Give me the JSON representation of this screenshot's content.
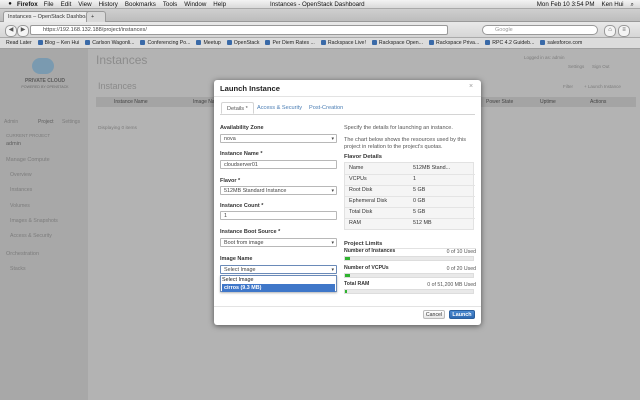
{
  "menubar": {
    "app": "Firefox",
    "items": [
      "File",
      "Edit",
      "View",
      "History",
      "Bookmarks",
      "Tools",
      "Window",
      "Help"
    ],
    "window_title": "Instances - OpenStack Dashboard",
    "user": "Ken Hui",
    "clock": "Mon Feb 10  3:54 PM"
  },
  "browser": {
    "tab_title": "Instances – OpenStack Dashboa...",
    "new_tab": "+",
    "url": "https://192.168.132.188/project/instances/",
    "search_placeholder": "Google",
    "bookmarks": [
      "Read Later",
      "Blog – Ken Hui",
      "Carlson Wagonli...",
      "Conferencing Po...",
      "Meetup",
      "OpenStack",
      "Per Diem Rates ...",
      "Rackspace Live!",
      "Rackspace Open...",
      "Rackspace Priva...",
      "RPC 4.2 Guideb...",
      "salesforce.com"
    ]
  },
  "dashboard": {
    "logo_line1": "PRIVATE CLOUD",
    "logo_line2": "POWERED BY OPENSTACK",
    "page_title": "Instances",
    "subtitle": "Instances",
    "sidebar_tabs": [
      "Admin",
      "Project",
      "Settings"
    ],
    "project_label": "CURRENT PROJECT",
    "project_name": "admin",
    "manage_compute": "Manage Compute",
    "nav": [
      "Overview",
      "Instances",
      "Volumes",
      "Images & Snapshots",
      "Access & Security"
    ],
    "orchestration": "Orchestration",
    "stacks": "Stacks",
    "logged_in": "Logged in as: admin",
    "settings_link": "Settings",
    "signout": "Sign Out",
    "filter_btn": "Filter",
    "launch_btn": "+ Launch Instance",
    "columns": [
      "Instance Name",
      "Image Name",
      "Power State",
      "Uptime",
      "Actions"
    ],
    "displaying": "Displaying 0 items"
  },
  "modal": {
    "title": "Launch Instance",
    "close": "×",
    "tabs": [
      "Details *",
      "Access & Security",
      "Post-Creation"
    ],
    "availability_zone_label": "Availability Zone",
    "availability_zone_value": "nova",
    "instance_name_label": "Instance Name *",
    "instance_name_value": "cloudserver01",
    "flavor_label": "Flavor *",
    "flavor_value": "512MB Standard Instance",
    "instance_count_label": "Instance Count *",
    "instance_count_value": "1",
    "boot_source_label": "Instance Boot Source *",
    "boot_source_value": "Boot from image",
    "image_name_label": "Image Name",
    "image_name_value": "Select Image",
    "image_options": [
      "Select Image",
      "cirros (9.3 MB)"
    ],
    "help_line1": "Specify the details for launching an instance.",
    "help_line2": "The chart below shows the resources used by this project in relation to the project's quotas.",
    "flavor_details_title": "Flavor Details",
    "flavor_details": [
      {
        "k": "Name",
        "v": "512MB Stand..."
      },
      {
        "k": "VCPUs",
        "v": "1"
      },
      {
        "k": "Root Disk",
        "v": "5 GB"
      },
      {
        "k": "Ephemeral Disk",
        "v": "0 GB"
      },
      {
        "k": "Total Disk",
        "v": "5 GB"
      },
      {
        "k": "RAM",
        "v": "512 MB"
      }
    ],
    "limits_title": "Project Limits",
    "limits": [
      {
        "label": "Number of Instances",
        "usage": "0 of 10 Used",
        "fill": 0.04
      },
      {
        "label": "Number of VCPUs",
        "usage": "0 of 20 Used",
        "fill": 0.04
      },
      {
        "label": "Total RAM",
        "usage": "0 of 51,200 MB Used",
        "fill": 0.01
      }
    ],
    "cancel": "Cancel",
    "launch": "Launch"
  },
  "colors": {
    "accent": "#3f77c9",
    "quota_bar": "#2fb32f",
    "primary_button": "#2f6ab2"
  }
}
